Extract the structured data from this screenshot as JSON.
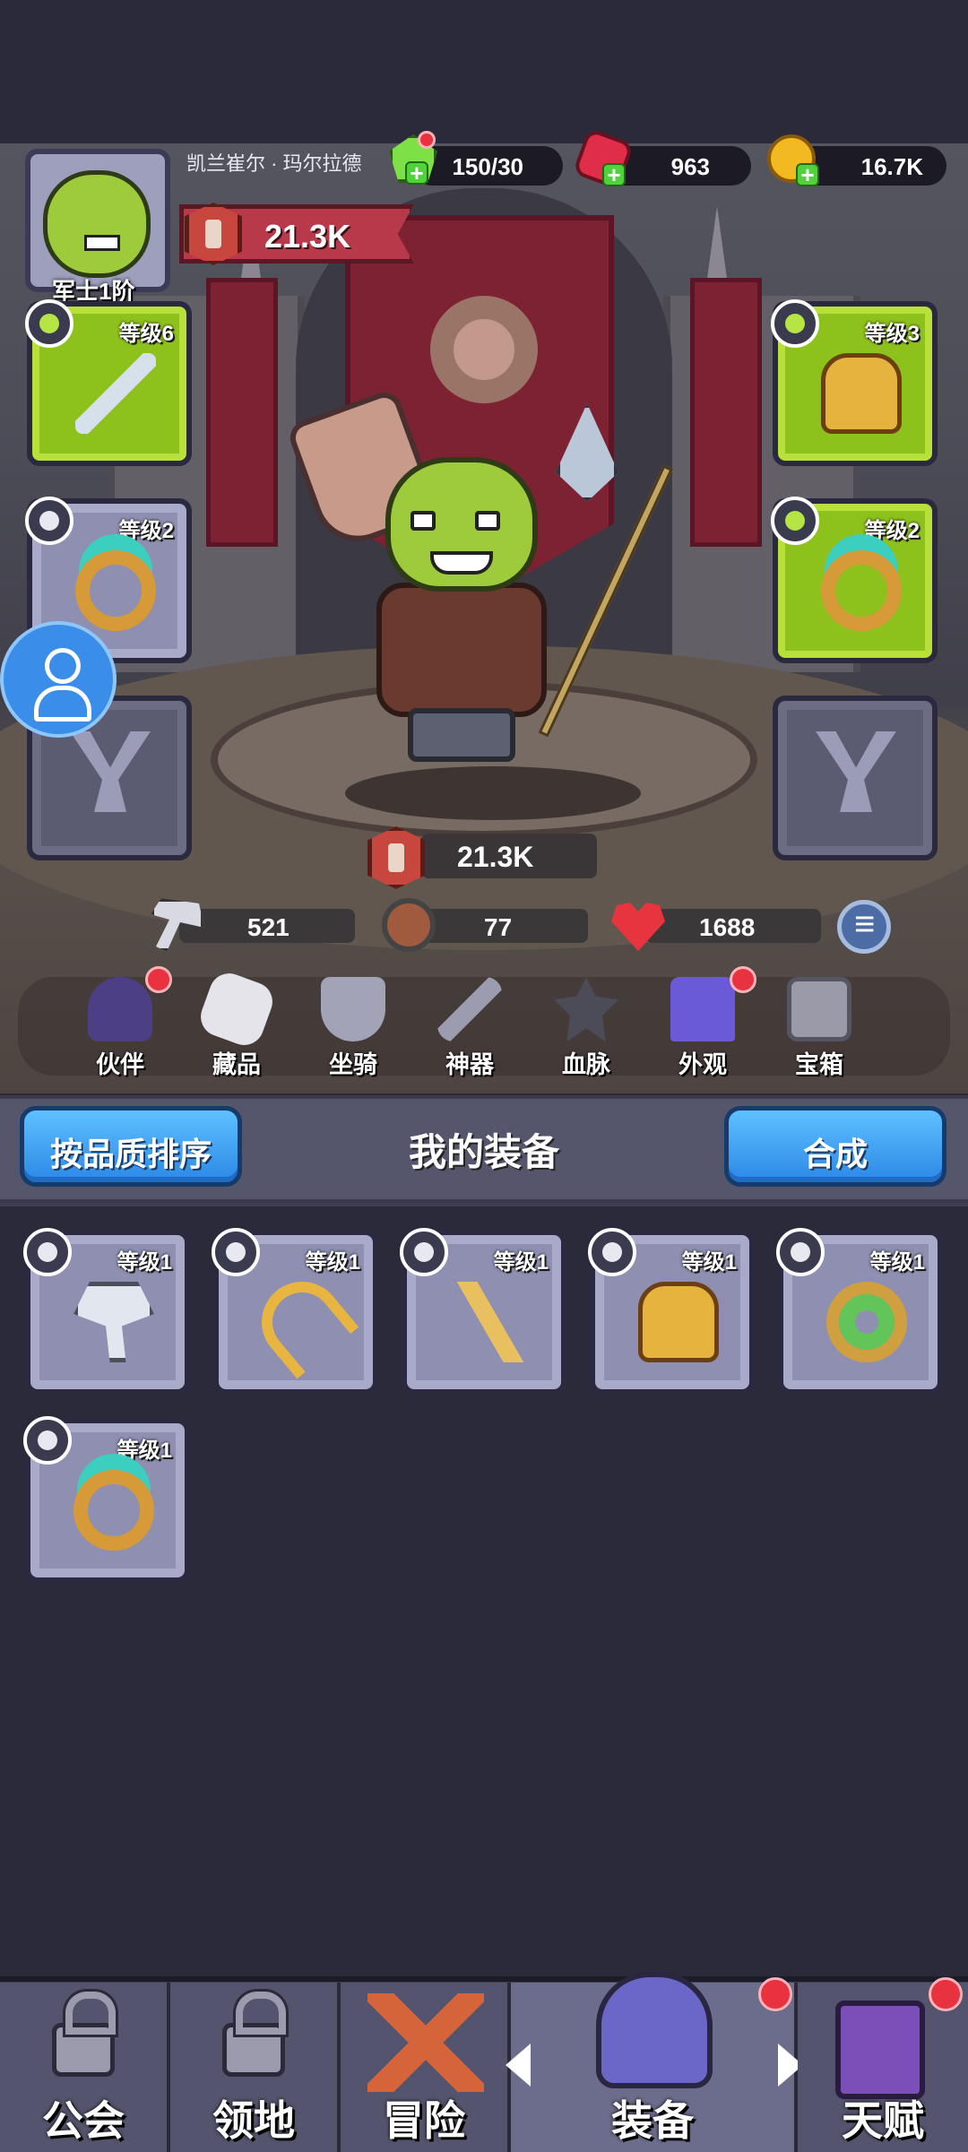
{
  "player": {
    "name": "凯兰崔尔 · 玛尔拉德",
    "rank": "军士1阶",
    "power": "21.3K"
  },
  "resources": {
    "energy": "150/30",
    "gems": "963",
    "gold": "16.7K"
  },
  "slots": {
    "weapon_level": "等级6",
    "armor_level": "等级3",
    "ring_left_level": "等级2",
    "ring_right_level": "等级2"
  },
  "hero": {
    "power": "21.3K",
    "attack": "521",
    "defense": "77",
    "hp": "1688"
  },
  "menu": {
    "companion": "伙伴",
    "collection": "藏品",
    "mount": "坐骑",
    "artifact": "神器",
    "bloodline": "血脉",
    "appearance": "外观",
    "chest": "宝箱"
  },
  "equipment_bar": {
    "sort_button": "按品质排序",
    "title": "我的装备",
    "merge_button": "合成"
  },
  "inventory": [
    {
      "type": "axe",
      "level": "等级1"
    },
    {
      "type": "bow",
      "level": "等级1"
    },
    {
      "type": "staff",
      "level": "等级1"
    },
    {
      "type": "armor",
      "level": "等级1"
    },
    {
      "type": "orb-ring",
      "level": "等级1"
    },
    {
      "type": "ring",
      "level": "等级1"
    }
  ],
  "bottom_nav": {
    "guild": "公会",
    "territory": "领地",
    "adventure": "冒险",
    "equipment": "装备",
    "talent": "天赋"
  },
  "colors": {
    "accent_blue": "#3a9bf0",
    "slot_green": "#8dc11b",
    "badge_red": "#e8323f"
  }
}
